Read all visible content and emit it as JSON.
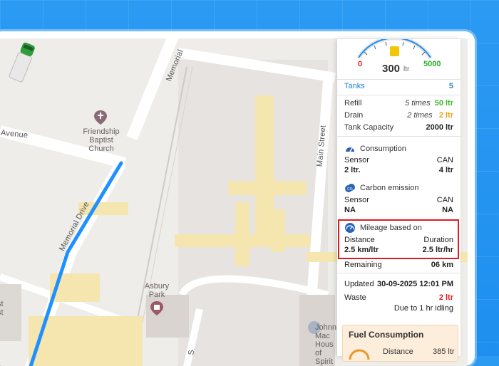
{
  "map": {
    "streets": {
      "avenue": "n Avenue",
      "memorial_top": "Memorial",
      "memorial_drive": "Memorial Drive",
      "main_street": "Main Street",
      "bottom_street": "S"
    },
    "pois": {
      "church": "Friendship\nBaptist\nChurch",
      "park": "Asbury\nPark",
      "left_partial": "t\nst\nst",
      "right_partial": "Johnn\nMac\nHous\nof\nSpirit"
    }
  },
  "panel": {
    "gauge": {
      "min": "0",
      "max": "5000",
      "value": "300",
      "unit": "ltr",
      "level_fraction": 0.06
    },
    "tanks": {
      "label": "Tanks",
      "value": "5"
    },
    "refill": {
      "label": "Refill",
      "times": "5 times",
      "amount": "50 ltr"
    },
    "drain": {
      "label": "Drain",
      "times": "2 times",
      "amount": "2 ltr"
    },
    "capacity": {
      "label": "Tank Capacity",
      "value": "2000 ltr"
    },
    "consumption": {
      "title": "Consumption",
      "left_label": "Sensor",
      "right_label": "CAN",
      "left_value": "2 ltr.",
      "right_value": "4 ltr"
    },
    "carbon": {
      "title": "Carbon emission",
      "left_label": "Sensor",
      "right_label": "CAN",
      "left_value": "NA",
      "right_value": "NA"
    },
    "mileage": {
      "title": "Mileage based on",
      "left_label": "Distance",
      "right_label": "Duration",
      "left_value": "2.5 km/ltr",
      "right_value": "2.5 ltr/hr"
    },
    "remaining": {
      "label": "Remaining",
      "value": "06 km"
    },
    "updated": {
      "label": "Updated",
      "value": "30-09-2025 12:01 PM"
    },
    "waste": {
      "label": "Waste",
      "value": "2 ltr",
      "note": "Due to 1 hr idling"
    },
    "fuel_card": {
      "title": "Fuel Consumption",
      "distance_label": "Distance",
      "distance_value": "385 ltr"
    }
  },
  "colors": {
    "accent_blue": "#1f8fef",
    "route": "#1e90ff",
    "min_red": "#e02020",
    "max_green": "#22b022",
    "refill_green": "#3cbb2c",
    "drain_orange": "#e8a317",
    "waste_red": "#e01a22",
    "highlight_border": "#e01a22"
  }
}
